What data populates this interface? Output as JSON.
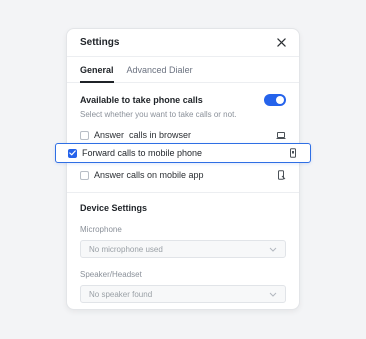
{
  "panel": {
    "title": "Settings",
    "close_icon": "close-icon"
  },
  "tabs": [
    {
      "label": "General",
      "active": true
    },
    {
      "label": "Advanced Dialer",
      "active": false
    }
  ],
  "availability": {
    "label": "Available to take phone calls",
    "description": "Select whether you want to take calls or not.",
    "toggle_on": true
  },
  "options": [
    {
      "label": "Answer  calls in browser",
      "checked": false,
      "icon": "laptop-icon"
    },
    {
      "label": "Forward calls to mobile phone",
      "checked": true,
      "icon": "mobile-phone-icon"
    },
    {
      "label": "Answer calls on mobile app",
      "checked": false,
      "icon": "mobile-app-icon"
    }
  ],
  "device_settings": {
    "title": "Device Settings",
    "microphone": {
      "label": "Microphone",
      "value": "No microphone used"
    },
    "speaker": {
      "label": "Speaker/Headset",
      "value": "No speaker found"
    }
  },
  "colors": {
    "accent": "#2563eb"
  }
}
